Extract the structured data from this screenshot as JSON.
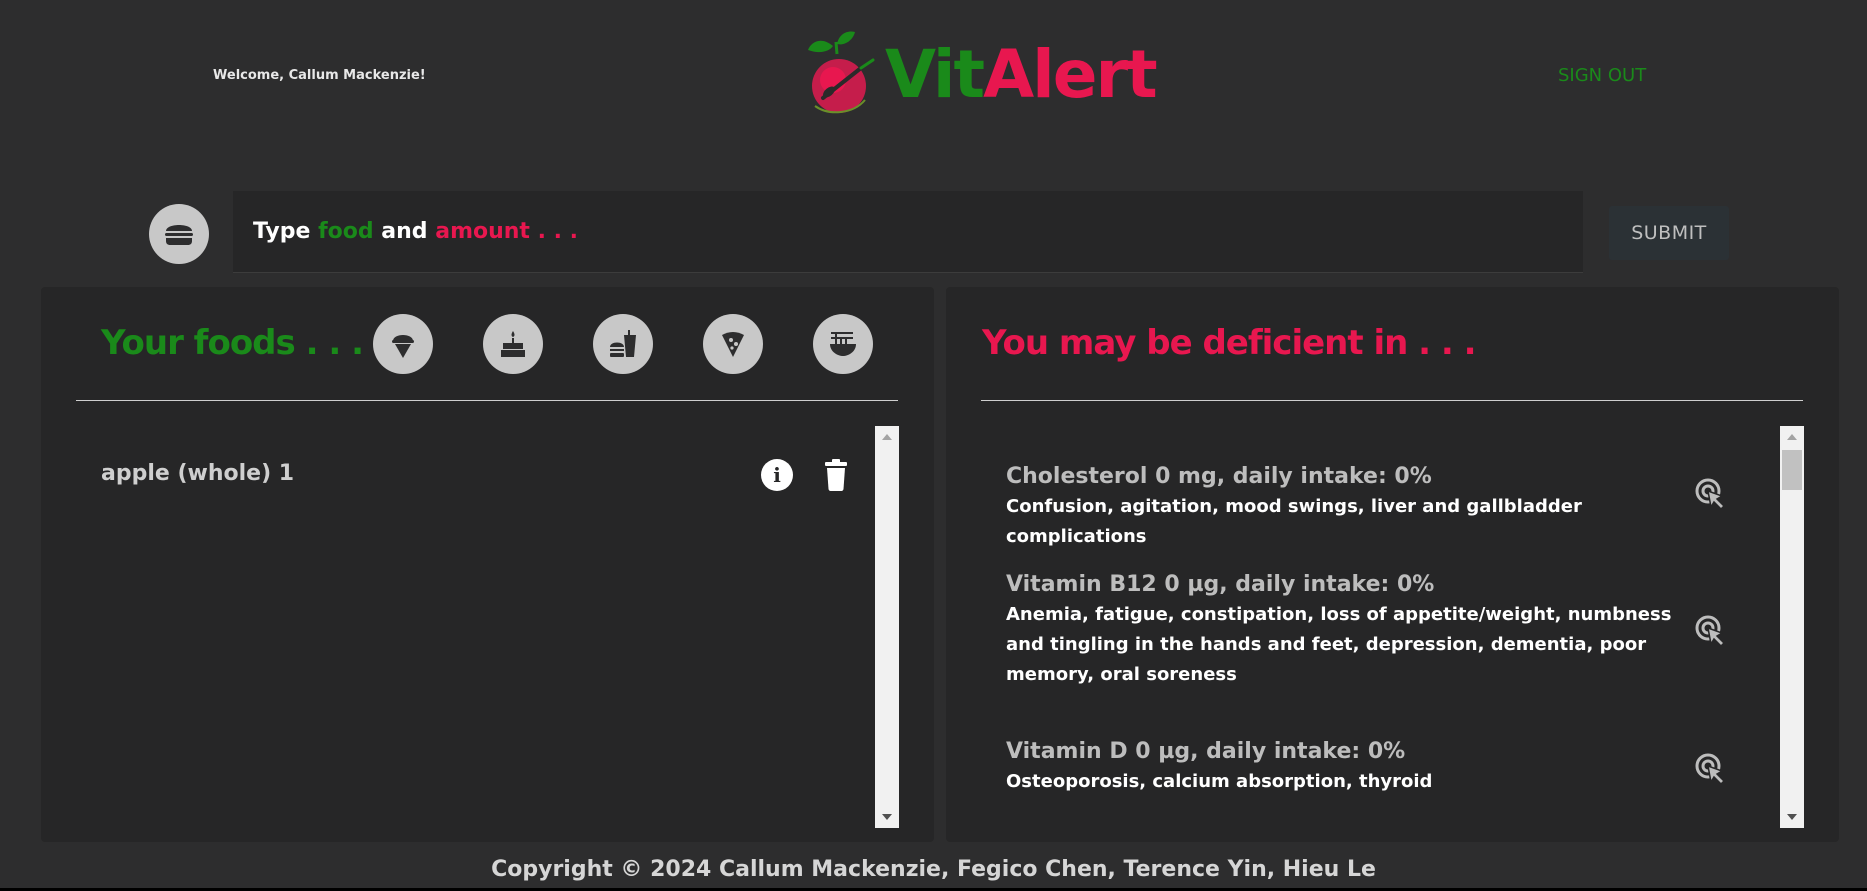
{
  "header": {
    "welcome": "Welcome, Callum Mackenzie!",
    "brand_vit": "Vit",
    "brand_alert": "Alert",
    "sign_out": "SIGN OUT"
  },
  "search": {
    "placeholder_type": "Type ",
    "placeholder_food": "food",
    "placeholder_and": " and ",
    "placeholder_amount": "amount . . .",
    "submit_label": "SUBMIT"
  },
  "foods_panel": {
    "title": "Your foods . . .",
    "categories": [
      "ice-cream",
      "cake",
      "fast-food",
      "pizza",
      "noodles"
    ],
    "items": [
      {
        "name": "apple (whole) 1"
      }
    ]
  },
  "deficiency_panel": {
    "title": "You may be deficient in . . .",
    "items": [
      {
        "title": "Cholesterol 0 mg, daily intake: 0%",
        "description": "Confusion, agitation, mood swings, liver and gallbladder complications"
      },
      {
        "title": "Vitamin B12 0 µg, daily intake: 0%",
        "description": "Anemia, fatigue, constipation, loss of appetite/weight, numbness and tingling in the hands and feet, depression, dementia, poor memory, oral soreness"
      },
      {
        "title": "Vitamin D 0 µg, daily intake: 0%",
        "description": "Osteoporosis, calcium absorption, thyroid"
      }
    ]
  },
  "footer": {
    "copyright": "Copyright © 2024 Callum Mackenzie, Fegico Chen, Terence Yin, Hieu Le"
  },
  "colors": {
    "background": "#2d2d2e",
    "panel": "#262627",
    "brand_green": "#1a8a1a",
    "brand_red": "#e8174f"
  }
}
